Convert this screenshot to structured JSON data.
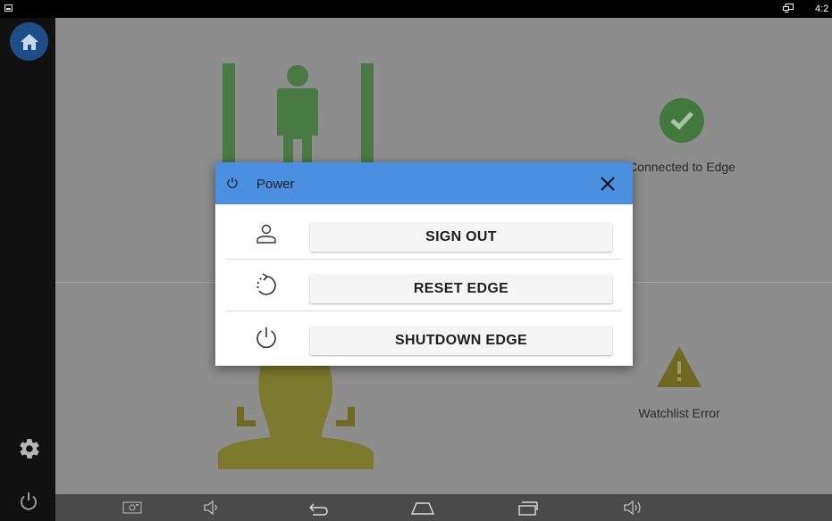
{
  "statusbar": {
    "clock": "4:2"
  },
  "rail": {
    "items": [
      {
        "icon": "home-icon"
      },
      {
        "icon": "gear-icon"
      },
      {
        "icon": "power-icon"
      }
    ]
  },
  "main": {
    "edge_status": {
      "icon": "check-circle-icon",
      "label": "Connected to Edge",
      "color": "#417a3c"
    },
    "watchlist_status": {
      "icon": "warning-icon",
      "label": "Watchlist Error",
      "color": "#6f6a20"
    }
  },
  "dialog": {
    "title": "Power",
    "header_color": "#4a8fe0",
    "actions": [
      {
        "icon": "person-icon",
        "label": "SIGN OUT"
      },
      {
        "icon": "reset-icon",
        "label": "RESET EDGE"
      },
      {
        "icon": "power-icon",
        "label": "SHUTDOWN EDGE"
      }
    ]
  },
  "navbar": {
    "items": [
      "screenshot-icon",
      "volume-down-icon",
      "back-icon",
      "home-nav-icon",
      "recents-icon",
      "volume-up-icon"
    ]
  }
}
